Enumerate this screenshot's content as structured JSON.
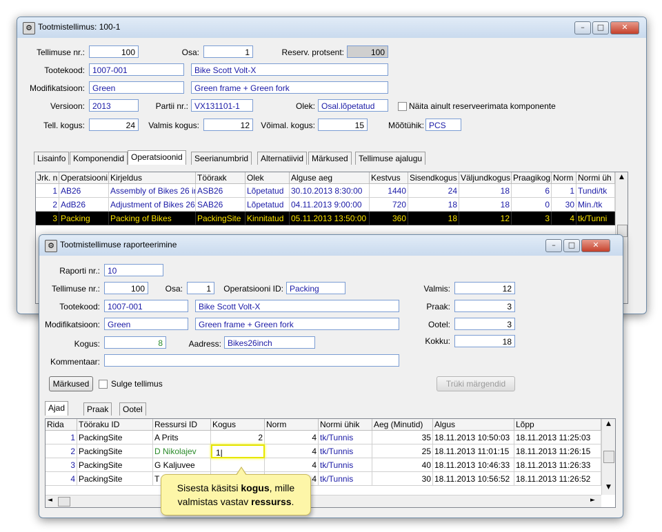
{
  "order_window": {
    "title": "Tootmistellimus: 100-1",
    "fields": {
      "order_no_label": "Tellimuse nr.:",
      "order_no": "100",
      "part_label": "Osa:",
      "part": "1",
      "reserve_label": "Reserv. protsent:",
      "reserve": "100",
      "product_code_label": "Tootekood:",
      "product_code": "1007-001",
      "product_name": "Bike Scott Volt-X",
      "modification_label": "Modifikatsioon:",
      "modification": "Green",
      "modification_desc": "Green frame + Green fork",
      "version_label": "Versioon:",
      "version": "2013",
      "batch_label": "Partii nr.:",
      "batch": "VX131101-1",
      "status_label": "Olek:",
      "status": "Osal.lõpetatud",
      "show_unreserved_label": "Näita ainult reserveerimata komponente",
      "ordered_qty_label": "Tell. kogus:",
      "ordered_qty": "24",
      "done_qty_label": "Valmis kogus:",
      "done_qty": "12",
      "possible_qty_label": "Võimal. kogus:",
      "possible_qty": "15",
      "unit_label": "Mõõtühik:",
      "unit": "PCS"
    },
    "tabs": [
      "Lisainfo",
      "Komponendid",
      "Operatsioonid",
      "Seerianumbrid",
      "Alternatiivid",
      "Märkused",
      "Tellimuse ajalugu"
    ],
    "active_tab": "Operatsioonid",
    "columns": [
      "Jrk. n",
      "Operatsiooni",
      "Kirjeldus",
      "Tööraкk",
      "Olek",
      "Alguse aeg",
      "Kestvus",
      "Sisendkogus",
      "Väljundkogus",
      "Praagikog",
      "Norm",
      "Normi üh"
    ],
    "rows": [
      [
        "1",
        "AB26",
        "Assembly of Bikes 26 in",
        "ASB26",
        "Lõpetatud",
        "30.10.2013 8:30:00",
        "1440",
        "24",
        "18",
        "6",
        "1",
        "Tundi/tk"
      ],
      [
        "2",
        "AdB26",
        "Adjustment of Bikes 26",
        "SAB26",
        "Lõpetatud",
        "04.11.2013 9:00:00",
        "720",
        "18",
        "18",
        "0",
        "30",
        "Min./tk"
      ],
      [
        "3",
        "Packing",
        "Packing of Bikes",
        "PackingSite",
        "Kinnitatud",
        "05.11.2013 13:50:00",
        "360",
        "18",
        "12",
        "3",
        "4",
        "tk/Tunni"
      ]
    ]
  },
  "report_window": {
    "title": "Tootmistellimuse raporteerimine",
    "fields": {
      "report_no_label": "Raporti nr.:",
      "report_no": "10",
      "order_no_label": "Tellimuse nr.:",
      "order_no": "100",
      "part_label": "Osa:",
      "part": "1",
      "operation_id_label": "Operatsiooni ID:",
      "operation_id": "Packing",
      "product_code_label": "Tootekood:",
      "product_code": "1007-001",
      "product_name": "Bike Scott Volt-X",
      "modification_label": "Modifikatsioon:",
      "modification": "Green",
      "modification_desc": "Green frame + Green fork",
      "qty_label": "Kogus:",
      "qty": "8",
      "address_label": "Aadress:",
      "address": "Bikes26inch",
      "comment_label": "Kommentaar:",
      "comment": "",
      "done_label": "Valmis:",
      "done": "12",
      "scrap_label": "Praak:",
      "scrap": "3",
      "waiting_label": "Ootel:",
      "waiting": "3",
      "total_label": "Kokku:",
      "total": "18",
      "close_order_label": "Sulge tellimus"
    },
    "buttons": {
      "notes": "Märkused",
      "print_labels": "Trüki märgendid"
    },
    "tabs": [
      "Ajad",
      "Praak",
      "Ootel"
    ],
    "active_tab": "Ajad",
    "columns": [
      "Rida",
      "Tööraku ID",
      "Ressursi ID",
      "Kogus",
      "Norm",
      "Normi ühik",
      "Aeg (Minutid)",
      "Algus",
      "Lõpp"
    ],
    "rows": [
      [
        "1",
        "PackingSite",
        "A Prits",
        "2",
        "4",
        "tk/Tunnis",
        "35",
        "18.11.2013 10:50:03",
        "18.11.2013 11:25:03"
      ],
      [
        "2",
        "PackingSite",
        "D Nikolajev",
        "1|",
        "4",
        "tk/Tunnis",
        "25",
        "18.11.2013 11:01:15",
        "18.11.2013 11:26:15"
      ],
      [
        "3",
        "PackingSite",
        "G Kaljuvee",
        "",
        "4",
        "tk/Tunnis",
        "40",
        "18.11.2013 10:46:33",
        "18.11.2013 11:26:33"
      ],
      [
        "4",
        "PackingSite",
        "T",
        "",
        "4",
        "tk/Tunnis",
        "30",
        "18.11.2013 10:56:52",
        "18.11.2013 11:26:52"
      ]
    ]
  },
  "tooltip": {
    "prefix": "Sisesta käsitsi ",
    "bold1": "kogus",
    "middle": ", mille valmistas vastav ",
    "bold2": "ressurss",
    "suffix": "."
  },
  "colors": {
    "highlight": "#ffe600",
    "tooltip_bg": "#fdf6a8",
    "link_blue": "#1a1aa6",
    "green_text": "#2a8a2a"
  }
}
